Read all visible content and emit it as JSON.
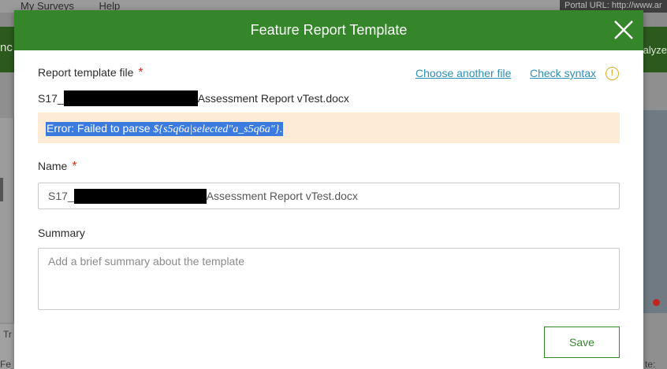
{
  "background": {
    "nav": [
      "My Surveys",
      "Help"
    ],
    "portal_url": "Portal URL: http://www.ar",
    "green_left": "nc",
    "green_right": "alyze",
    "bottom_left_1": "Fe",
    "bottom_left_2": "Tr",
    "bottom_right": "te:"
  },
  "modal": {
    "title": "Feature Report Template",
    "close_icon": "close-icon",
    "template_file": {
      "label": "Report template file",
      "required_mark": "*",
      "choose_link": "Choose another file",
      "check_link": "Check syntax",
      "warning_icon": "!",
      "filename_prefix": "S17_",
      "filename_suffix": "Assessment Report vTest.docx"
    },
    "error": {
      "prefix": "Error: Failed to parse ",
      "expression": "${s5q6a|selected\"a_s5q6a\"}",
      "suffix": "."
    },
    "name": {
      "label": "Name",
      "required_mark": "*",
      "value_prefix": "S17_",
      "value_suffix": "Assessment Report vTest.docx"
    },
    "summary": {
      "label": "Summary",
      "placeholder": "Add a brief summary about the template"
    },
    "save_label": "Save"
  },
  "colors": {
    "header_green": "#35862b",
    "link_blue": "#2b8fb8",
    "required_red": "#d83020",
    "error_bg": "#fdebd5",
    "selection_blue": "#3b7be0",
    "warning_yellow": "#e0b020"
  }
}
